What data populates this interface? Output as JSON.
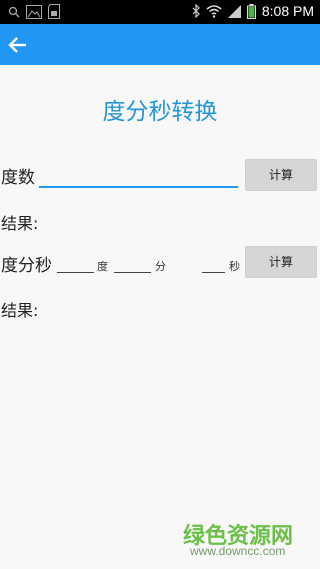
{
  "status_bar": {
    "time": "8:08 PM",
    "left_icons": [
      "search-icon",
      "image-icon",
      "sd-card-icon"
    ],
    "right_icons": [
      "bluetooth-icon",
      "wifi-icon",
      "signal-icon",
      "battery-icon"
    ]
  },
  "app_bar": {
    "back_icon": "arrow-left-icon",
    "color": "#2196f3"
  },
  "main": {
    "title": "度分秒转换",
    "degrees_label": "度数",
    "degrees_input": {
      "value": "",
      "placeholder": ""
    },
    "calc_button_1": "计算",
    "result_label_1": "结果:",
    "dms_label": "度分秒",
    "unit_degree": "度",
    "unit_minute": "分",
    "unit_second": "秒",
    "calc_button_2": "计算",
    "result_label_2": "结果:"
  },
  "watermark": {
    "logo": "绿色资源网",
    "url": "www.downcc.com"
  },
  "colors": {
    "accent": "#2196f3",
    "title": "#2596d6"
  }
}
